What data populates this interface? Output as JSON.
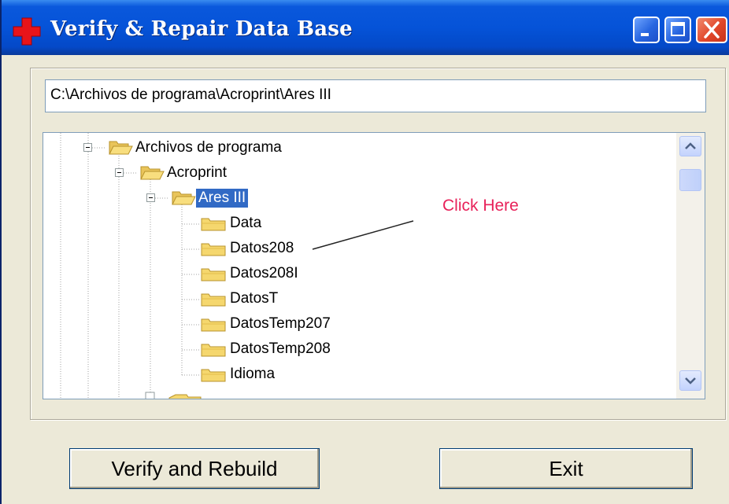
{
  "window": {
    "title": "Verify & Repair Data Base",
    "app_icon": "red-cross-icon",
    "controls": [
      "minimize-icon",
      "maximize-icon",
      "close-icon"
    ]
  },
  "path_field": {
    "value": "C:\\Archivos de programa\\Acroprint\\Ares III"
  },
  "tree": {
    "items": [
      {
        "label": "Archivos de programa",
        "expanded": true,
        "level": 1
      },
      {
        "label": "Acroprint",
        "expanded": true,
        "level": 2
      },
      {
        "label": "Ares III",
        "expanded": true,
        "selected": true,
        "level": 3
      },
      {
        "label": "Data",
        "level": 4
      },
      {
        "label": "Datos208",
        "level": 4
      },
      {
        "label": "Datos208I",
        "level": 4
      },
      {
        "label": "DatosT",
        "level": 4
      },
      {
        "label": "DatosTemp207",
        "level": 4
      },
      {
        "label": "DatosTemp208",
        "level": 4
      },
      {
        "label": "Idioma",
        "level": 4
      }
    ]
  },
  "annotation": {
    "text": "Click Here",
    "color": "#e8225a"
  },
  "buttons": {
    "verify": "Verify and Rebuild",
    "exit": "Exit"
  },
  "colors": {
    "titlebar": "#0553d8",
    "selection": "#316ac5",
    "folder": "#f5d76e"
  }
}
